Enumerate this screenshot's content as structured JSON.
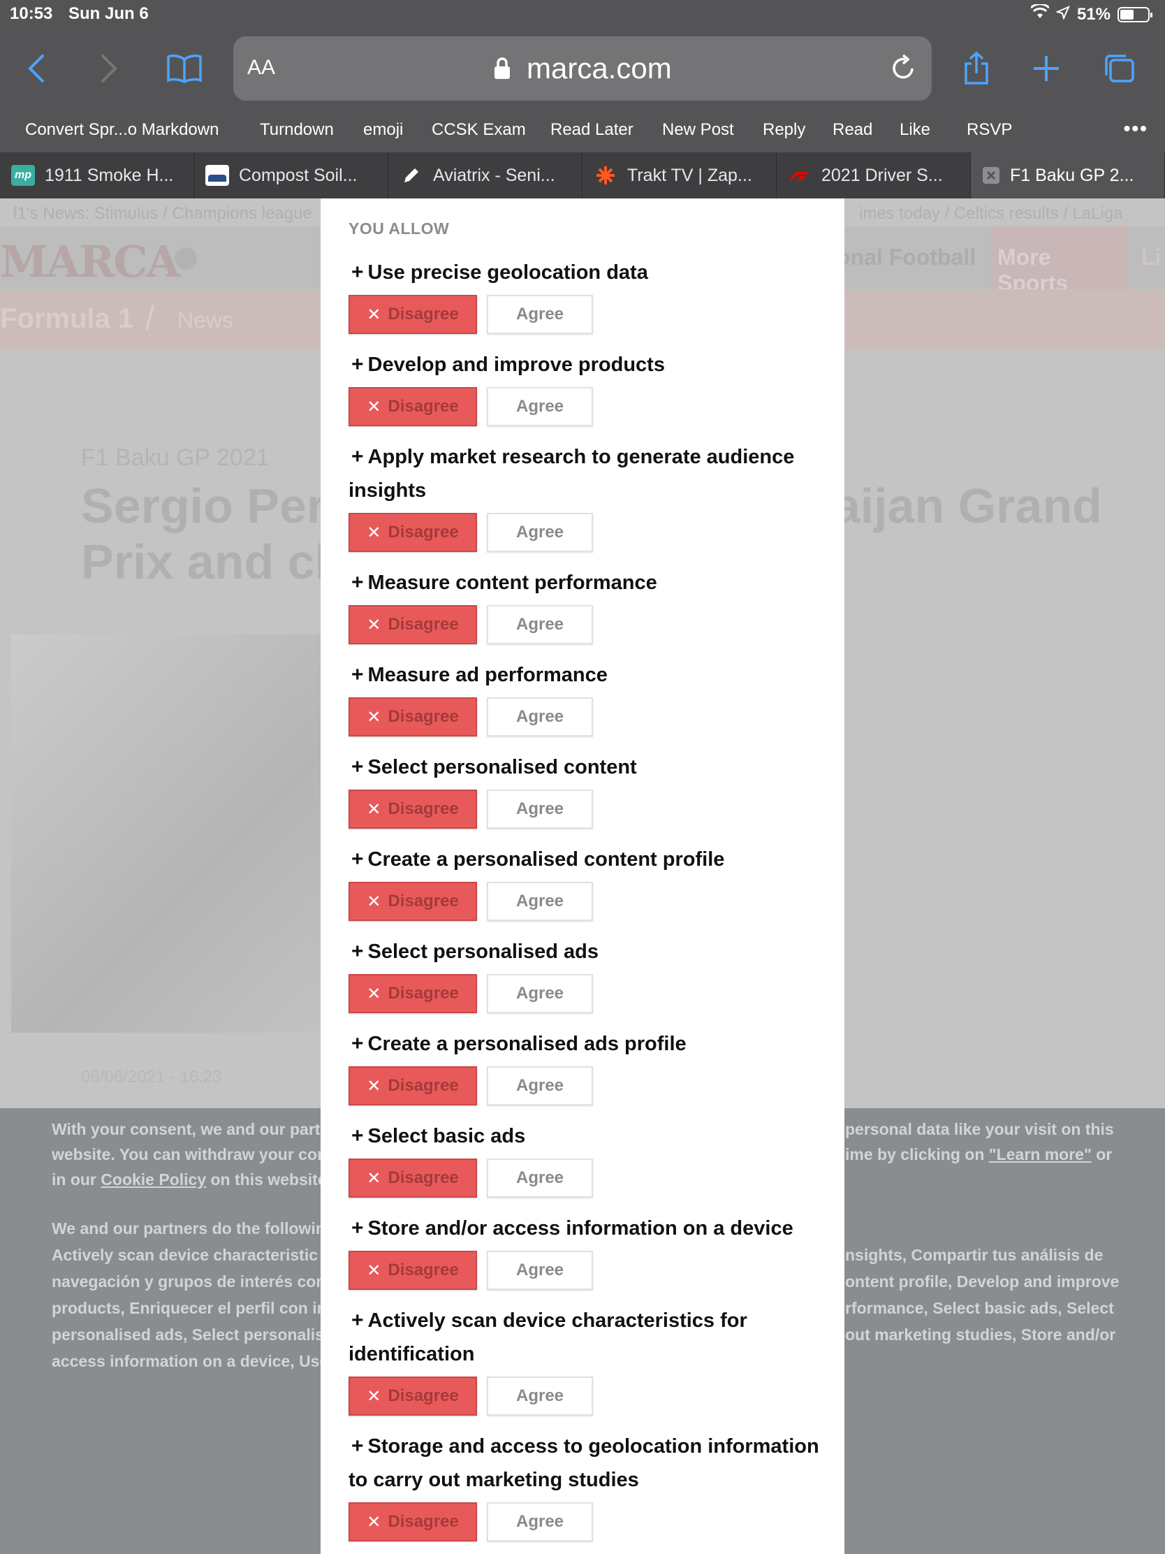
{
  "status": {
    "time": "10:53",
    "date": "Sun Jun 6",
    "battery": "51%",
    "battery_level": 0.51
  },
  "toolbar": {
    "url_text_size": "AA",
    "url": "marca.com"
  },
  "bookmarks": [
    "Convert Spr...o Markdown",
    "Turndown",
    "emoji",
    "CCSK Exam",
    "Read Later",
    "New Post",
    "Reply",
    "Read",
    "Like",
    "RSVP"
  ],
  "tabs": [
    {
      "label": "1911 Smoke H...",
      "favicon": "mp"
    },
    {
      "label": "Compost Soil..."
    },
    {
      "label": "Aviatrix - Seni..."
    },
    {
      "label": "Trakt TV | Zap..."
    },
    {
      "label": "2021 Driver S..."
    },
    {
      "label": "F1 Baku GP 2..."
    }
  ],
  "page": {
    "links_left": "f1's News:  Stimulus  /  Champions league",
    "links_right": "imes today  /  Celtics results  /  LaLiga",
    "logo": "MARCA",
    "nav_football": "onal Football",
    "nav_more_sports": "More Sports",
    "nav_live": "Li",
    "subnav_f1": "Formula 1",
    "subnav_sep": "/",
    "subnav_news": "News",
    "kicker": "F1 Baku GP 2021",
    "headline_l1": "Sergio Pere",
    "headline_r1": "baijan Grand",
    "headline_l2": "Prix and ch",
    "date": "06/06/2021 - 16:23",
    "cookie": {
      "l1a": "With your consent, we and our partn",
      "l1b": "personal data like your visit on this",
      "l2a": "website. You can withdraw your con",
      "l2b_pre": "ime by clicking on ",
      "l2b_link": "\"Learn more\"",
      "l2b_post": " or",
      "l3a_pre": "in our ",
      "l3a_link": "Cookie Policy",
      "l3a_post": " on this website",
      "l4a": "We and our partners do the followin",
      "l5a": "Actively  scan  device  characteristic",
      "l5b": "nsights,  Compartir  tus  análisis  de",
      "l6a": "navegación y grupos de interés con",
      "l6b": "ontent profile, Develop and improve",
      "l7a": "products, Enriquecer el perfil con in",
      "l7b": "rformance, Select basic ads, Select",
      "l8a": "personalised ads, Select personalis",
      "l8b": "out marketing studies, Store and/or",
      "l9a": "access information on a device, Use"
    }
  },
  "modal": {
    "section_heading": "YOU ALLOW",
    "disagree_label": "Disagree",
    "agree_label": "Agree",
    "purposes": [
      {
        "title": "Use precise geolocation data"
      },
      {
        "title": "Develop and improve products"
      },
      {
        "title": "Apply market research to generate audience insights"
      },
      {
        "title": "Measure content performance"
      },
      {
        "title": "Measure ad performance"
      },
      {
        "title": "Select personalised content"
      },
      {
        "title": "Create a personalised content profile"
      },
      {
        "title": "Select personalised ads"
      },
      {
        "title": "Create a personalised ads profile"
      },
      {
        "title": "Select basic ads"
      },
      {
        "title": "Store and/or access information on a device"
      },
      {
        "title": "Actively scan device characteristics for identification"
      },
      {
        "title": "Storage and access to geolocation information to carry out marketing studies"
      }
    ]
  }
}
